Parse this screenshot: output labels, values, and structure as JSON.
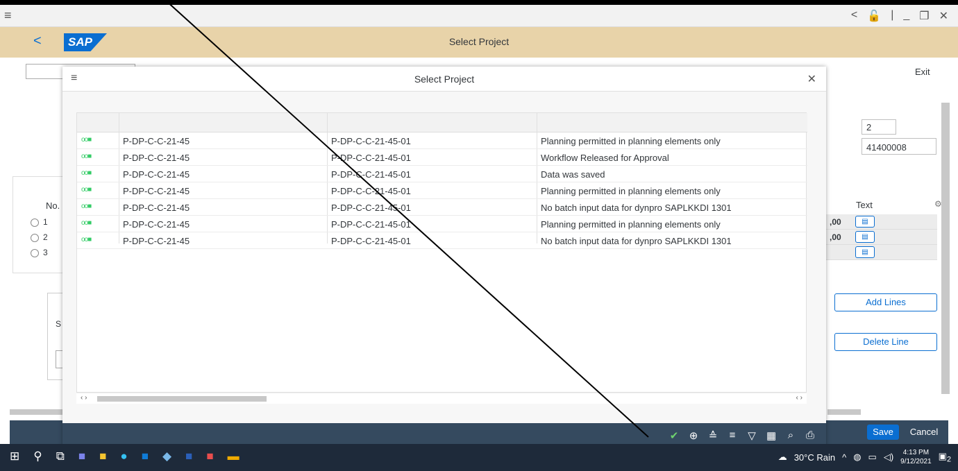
{
  "window": {
    "menu_icon": "hamburger-icon",
    "controls": [
      "<",
      "🔓",
      "|",
      "_",
      "❐",
      "✕"
    ]
  },
  "shell": {
    "title": "Select Project",
    "logo": "SAP",
    "back": "<"
  },
  "background": {
    "exit_label": "Exit",
    "field_value_1": "2",
    "field_value_2": "41400008",
    "table_header_no": "No.",
    "rows": [
      "1",
      "2",
      "3"
    ],
    "text_header": "Text",
    "amounts": [
      ",00",
      ",00"
    ],
    "side_label": "S",
    "add_lines_label": "Add Lines",
    "delete_line_label": "Delete Line",
    "save_label": "Save",
    "cancel_label": "Cancel"
  },
  "dialog": {
    "title": "Select Project",
    "close": "✕",
    "rows": [
      {
        "status": "oo■",
        "project": "P-DP-C-C-21-45",
        "wbs": "P-DP-C-C-21-45-01",
        "message": "Planning permitted in planning elements only"
      },
      {
        "status": "oo■",
        "project": "P-DP-C-C-21-45",
        "wbs": "P-DP-C-C-21-45-01",
        "message": "Workflow Released for Approval"
      },
      {
        "status": "oo■",
        "project": "P-DP-C-C-21-45",
        "wbs": "P-DP-C-C-21-45-01",
        "message": "Data was saved"
      },
      {
        "status": "oo■",
        "project": "P-DP-C-C-21-45",
        "wbs": "P-DP-C-C-21-45-01",
        "message": "Planning permitted in planning elements only"
      },
      {
        "status": "oo■",
        "project": "P-DP-C-C-21-45",
        "wbs": "P-DP-C-C-21-45-01",
        "message": "No batch input data for dynpro SAPLKKDI 1301"
      },
      {
        "status": "oo■",
        "project": "P-DP-C-C-21-45",
        "wbs": "P-DP-C-C-21-45-01",
        "message": "Planning permitted in planning elements only"
      },
      {
        "status": "oo■",
        "project": "P-DP-C-C-21-45",
        "wbs": "P-DP-C-C-21-45-01",
        "message": "No batch input data for dynpro SAPLKKDI 1301"
      }
    ],
    "tools": [
      "✔",
      "⊕",
      "≙",
      "≡",
      "▽",
      "▦",
      "⌕",
      "⎙"
    ]
  },
  "taskbar": {
    "weather": "30°C  Rain",
    "time": "4:13 PM",
    "date": "9/12/2021",
    "notif": "2"
  }
}
